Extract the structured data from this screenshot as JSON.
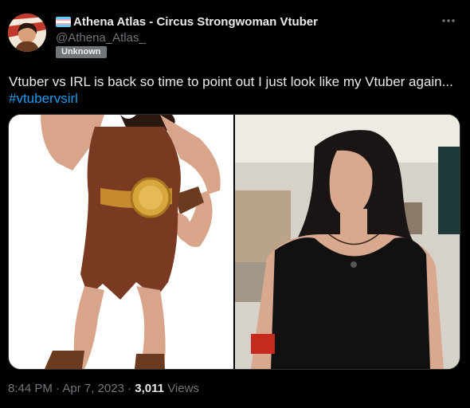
{
  "author": {
    "display_name": "Athena Atlas - Circus Strongwoman Vtuber",
    "handle": "@Athena_Atlas_",
    "label_badge": "Unknown",
    "flag_colors": [
      "#5bcefa",
      "#f5a9b8",
      "#ffffff",
      "#f5a9b8",
      "#5bcefa"
    ]
  },
  "tweet": {
    "text": "Vtuber vs IRL is back so time to point out I just look like my Vtuber again...",
    "hashtag": "#vtubervsirl",
    "time": "8:44 PM",
    "separator": "·",
    "date": "Apr 7, 2023",
    "views_count": "3,011",
    "views_label": "Views"
  },
  "icons": {
    "more": "more-options-icon",
    "flag": "transgender-flag-icon"
  },
  "colors": {
    "background": "#000000",
    "text": "#e7e9ea",
    "secondary": "#71767b",
    "link": "#1d9bf0",
    "border": "#2f3336"
  }
}
